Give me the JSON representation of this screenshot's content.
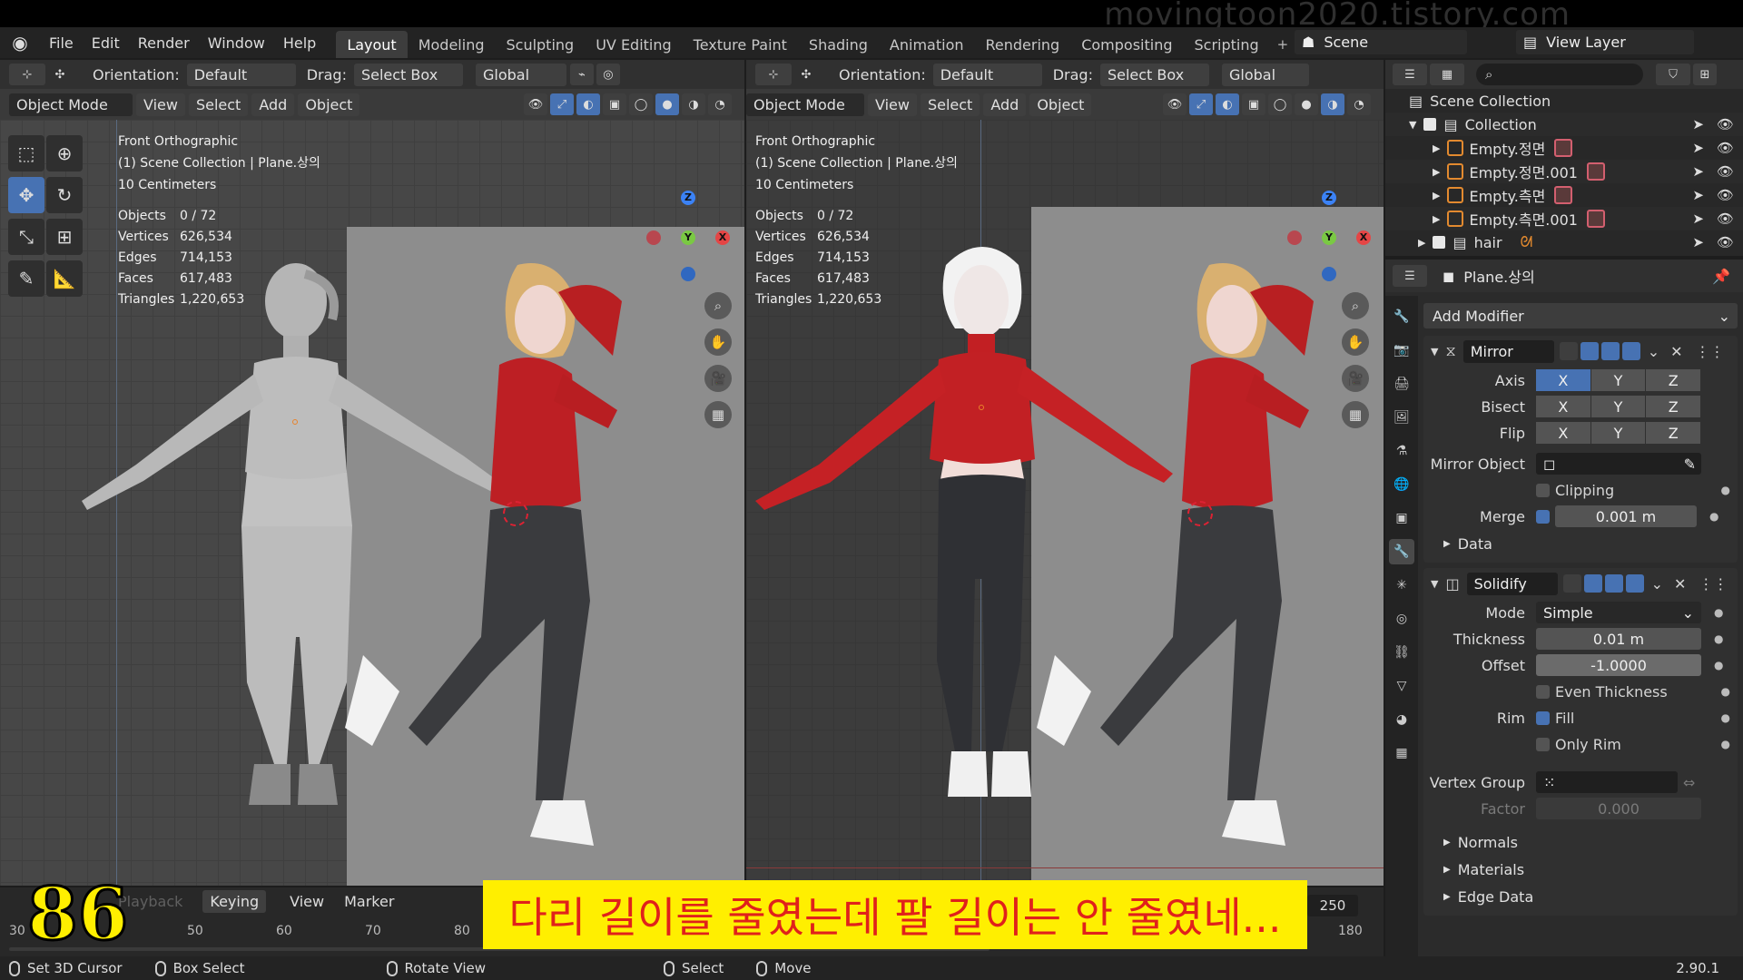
{
  "watermark": "movingtoon2020.tistory.com",
  "menu": [
    "File",
    "Edit",
    "Render",
    "Window",
    "Help"
  ],
  "workspace_tabs": [
    "Layout",
    "Modeling",
    "Sculpting",
    "UV Editing",
    "Texture Paint",
    "Shading",
    "Animation",
    "Rendering",
    "Compositing",
    "Scripting"
  ],
  "active_tab": "Layout",
  "scene": "Scene",
  "view_layer": "View Layer",
  "viewport_header": {
    "orientation_label": "Orientation:",
    "orientation_value": "Default",
    "drag_label": "Drag:",
    "drag_value": "Select Box",
    "transform_value": "Global",
    "mode": "Object Mode",
    "view": "View",
    "select": "Select",
    "add": "Add",
    "object": "Object"
  },
  "viewport_info": {
    "view_name": "Front Orthographic",
    "collection": "(1) Scene Collection | Plane.상의",
    "scale": "10 Centimeters",
    "stats": [
      {
        "k": "Objects",
        "v": "0 / 72"
      },
      {
        "k": "Vertices",
        "v": "626,534"
      },
      {
        "k": "Edges",
        "v": "714,153"
      },
      {
        "k": "Faces",
        "v": "617,483"
      },
      {
        "k": "Triangles",
        "v": "1,220,653"
      }
    ]
  },
  "gizmo": {
    "z": "Z",
    "y": "Y",
    "x": "X"
  },
  "outliner": {
    "root": "Scene Collection",
    "rows": [
      {
        "label": "Collection"
      },
      {
        "label": "Empty.정면"
      },
      {
        "label": "Empty.정면.001"
      },
      {
        "label": "Empty.측면"
      },
      {
        "label": "Empty.측면.001"
      },
      {
        "label": "hair"
      }
    ]
  },
  "properties": {
    "object_name": "Plane.상의",
    "add_modifier": "Add Modifier",
    "mirror": {
      "name": "Mirror",
      "axis_label": "Axis",
      "bisect_label": "Bisect",
      "flip_label": "Flip",
      "x": "X",
      "y": "Y",
      "z": "Z",
      "mirror_object_label": "Mirror Object",
      "clipping": "Clipping",
      "merge_label": "Merge",
      "merge_value": "0.001 m",
      "data": "Data"
    },
    "solidify": {
      "name": "Solidify",
      "mode_label": "Mode",
      "mode_value": "Simple",
      "thickness_label": "Thickness",
      "thickness_value": "0.01 m",
      "offset_label": "Offset",
      "offset_value": "-1.0000",
      "even_thickness": "Even Thickness",
      "rim_label": "Rim",
      "fill": "Fill",
      "only_rim": "Only Rim",
      "vertex_group_label": "Vertex Group",
      "factor_label": "Factor",
      "factor_value": "0.000",
      "normals": "Normals",
      "materials": "Materials",
      "edge_data": "Edge Data"
    }
  },
  "timeline": {
    "playback": "Playback",
    "keying": "Keying",
    "view": "View",
    "marker": "Marker",
    "end_frame": "250",
    "ticks": [
      "30",
      "50",
      "60",
      "70",
      "80",
      "180"
    ]
  },
  "overlay": {
    "frame_number": "86",
    "subtitle": "다리 길이를 줄였는데 팔 길이는 안 줄였네..."
  },
  "statusbar": {
    "items": [
      "Set 3D Cursor",
      "Box Select",
      "Rotate View",
      "Select",
      "Move"
    ],
    "version": "2.90.1"
  }
}
